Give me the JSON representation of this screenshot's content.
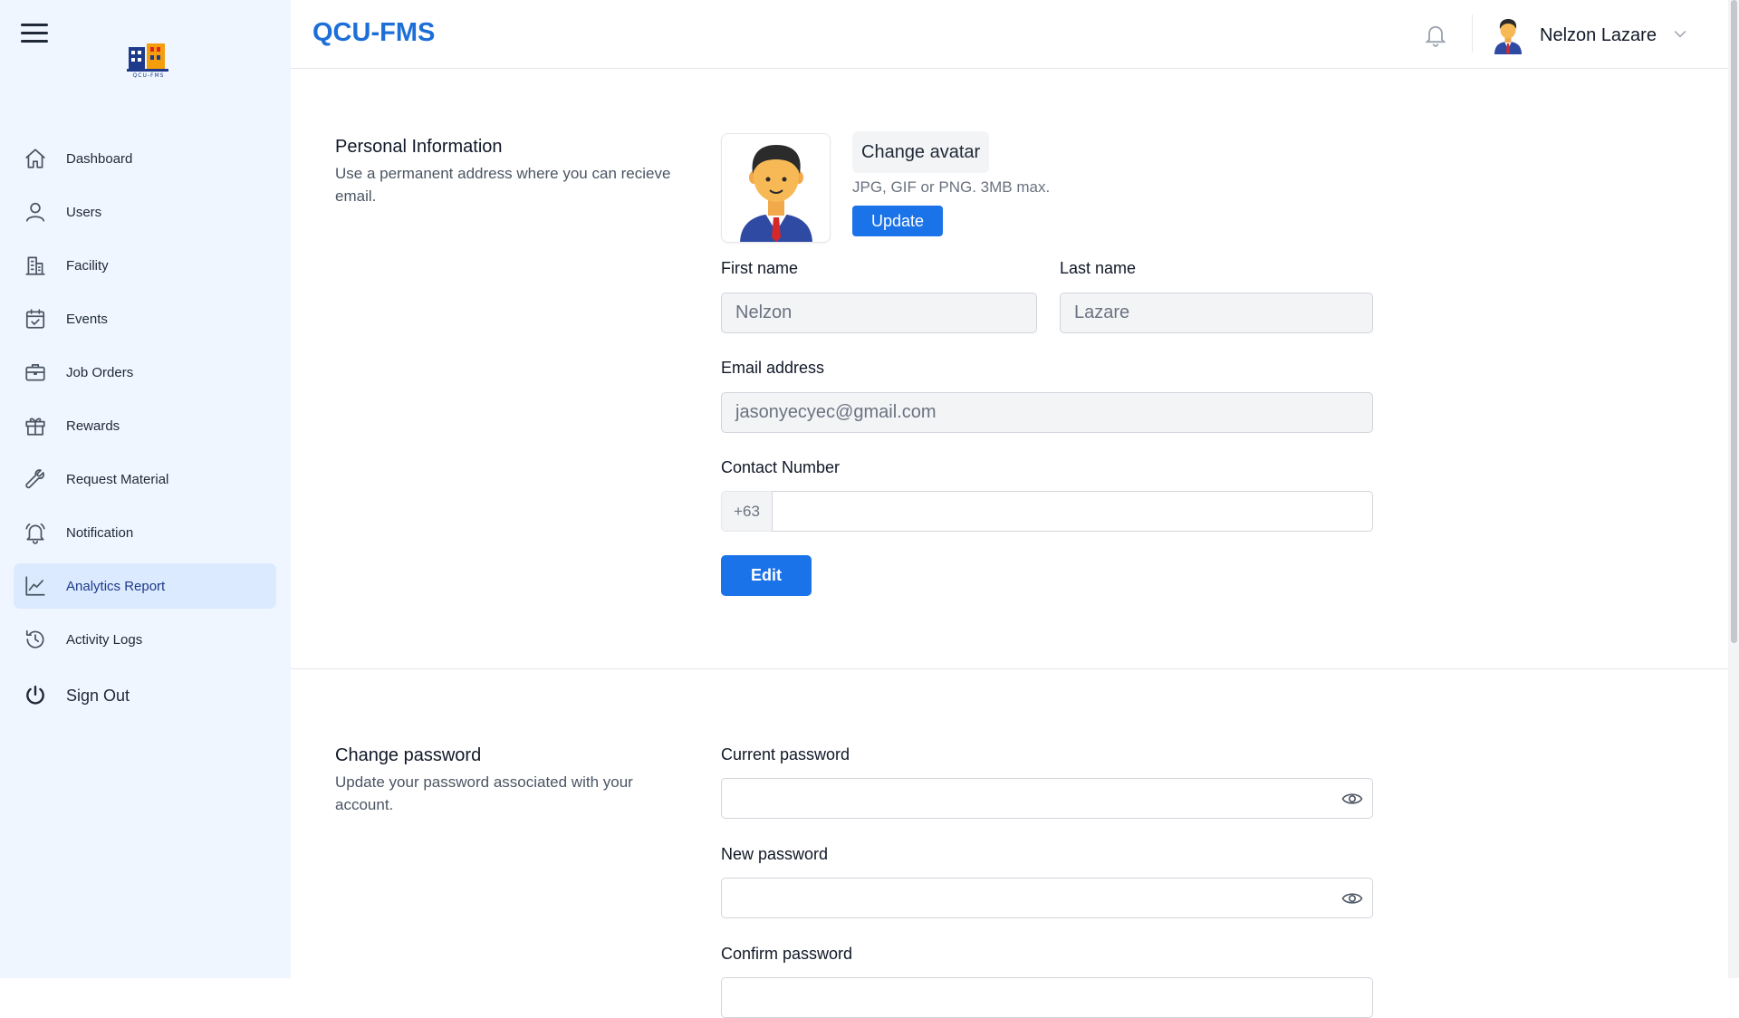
{
  "app": {
    "title": "QCU-FMS",
    "logo_text": "QCU-FMS"
  },
  "sidebar": {
    "items": [
      {
        "label": "Dashboard",
        "icon": "home-icon"
      },
      {
        "label": "Users",
        "icon": "user-icon"
      },
      {
        "label": "Facility",
        "icon": "building-icon"
      },
      {
        "label": "Events",
        "icon": "calendar-check-icon"
      },
      {
        "label": "Job Orders",
        "icon": "briefcase-icon"
      },
      {
        "label": "Rewards",
        "icon": "gift-icon"
      },
      {
        "label": "Request Material",
        "icon": "wrench-icon"
      },
      {
        "label": "Notification",
        "icon": "bell-icon"
      },
      {
        "label": "Analytics Report",
        "icon": "chart-line-icon",
        "active": true
      },
      {
        "label": "Activity Logs",
        "icon": "history-icon"
      }
    ],
    "signout_label": "Sign Out"
  },
  "header": {
    "user_name": "Nelzon Lazare"
  },
  "personal": {
    "title": "Personal Information",
    "description": "Use a permanent address where you can recieve email.",
    "change_avatar_label": "Change avatar",
    "avatar_hint": "JPG, GIF or PNG. 3MB max.",
    "update_label": "Update",
    "first_name_label": "First name",
    "first_name_value": "Nelzon",
    "last_name_label": "Last name",
    "last_name_value": "Lazare",
    "email_label": "Email address",
    "email_value": "jasonyecyec@gmail.com",
    "contact_label": "Contact Number",
    "contact_prefix": "+63",
    "contact_value": "",
    "edit_label": "Edit"
  },
  "password": {
    "title": "Change password",
    "description": "Update your password associated with your account.",
    "current_label": "Current password",
    "new_label": "New password",
    "confirm_label": "Confirm password"
  },
  "colors": {
    "accent": "#1a73e8",
    "sidebar_bg": "#eff6ff",
    "active_bg": "#dbeafe",
    "title": "#1d6fd8"
  }
}
